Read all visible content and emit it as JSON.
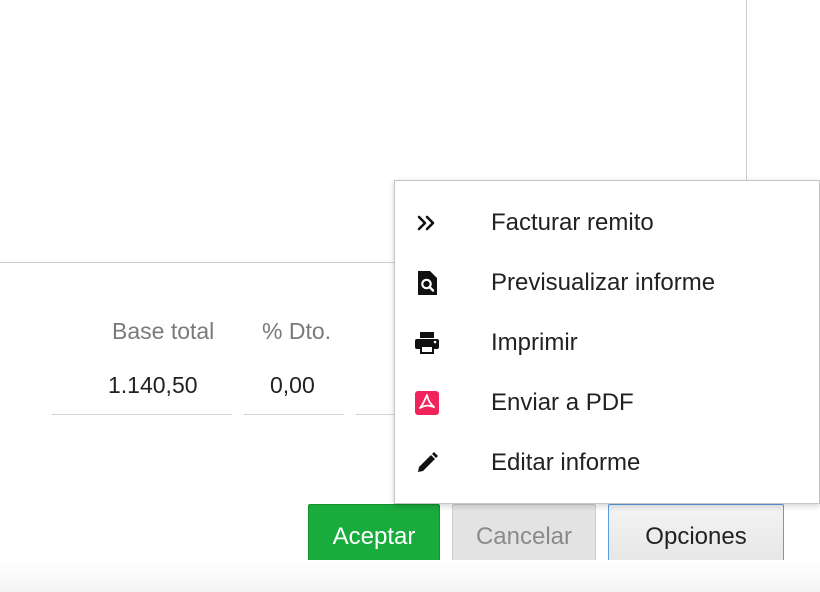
{
  "summary": {
    "columns": [
      {
        "label": "Base total",
        "value": "1.140,50"
      },
      {
        "label": "% Dto.",
        "value": "0,00"
      }
    ]
  },
  "buttons": {
    "accept": "Aceptar",
    "cancel": "Cancelar",
    "options": "Opciones"
  },
  "options_menu": {
    "items": [
      {
        "label": "Facturar remito",
        "icon": "double-chevron-right-icon"
      },
      {
        "label": "Previsualizar informe",
        "icon": "document-search-icon"
      },
      {
        "label": "Imprimir",
        "icon": "printer-icon"
      },
      {
        "label": "Enviar a PDF",
        "icon": "pdf-icon",
        "icon_color": "#f0245a"
      },
      {
        "label": "Editar informe",
        "icon": "pencil-icon"
      }
    ]
  },
  "colors": {
    "accept_button": "#1aab3d",
    "options_border": "#5b9ee8",
    "pdf_icon": "#f0245a"
  }
}
